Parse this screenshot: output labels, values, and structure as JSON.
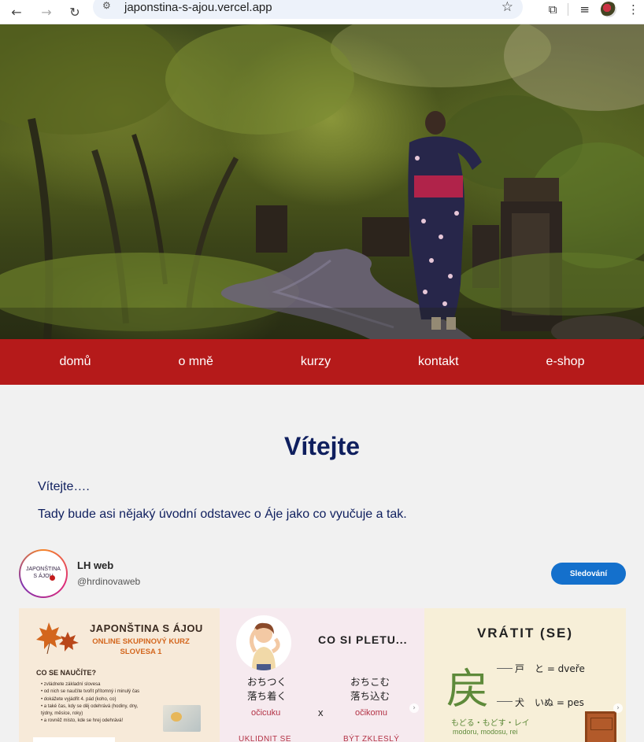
{
  "browser": {
    "url": "japonstina-s-ajou.vercel.app",
    "back_icon": "arrow-left-icon",
    "forward_icon": "arrow-right-icon",
    "reload_icon": "reload-icon",
    "bookmark_icon": "star-icon"
  },
  "menu": {
    "items": [
      {
        "label": "domů"
      },
      {
        "label": "o mně"
      },
      {
        "label": "kurzy"
      },
      {
        "label": "kontakt"
      },
      {
        "label": "e-shop"
      }
    ],
    "color": "#b51a1a"
  },
  "main": {
    "heading": "Vítejte",
    "intro": "Vítejte….",
    "paragraph": "Tady bude asi nějaký úvodní odstavec o Áje jako co vyučuje a tak."
  },
  "instagram": {
    "avatar_line1": "JAPONŠTINA",
    "avatar_line2": "S ÁJOU",
    "name": "LH web",
    "handle": "@hrdinovaweb",
    "follow_label": "Sledování",
    "posts": [
      {
        "title": "JAPONŠTINA S ÁJOU",
        "subtitle_line1": "ONLINE SKUPINOVÝ KURZ",
        "subtitle_line2": "SLOVESA 1",
        "heading": "CO SE NAUČÍTE?",
        "bullets": [
          "• zvládnete základní slovesa",
          "• od nich se naučíte tvořit přítomný i minulý čas",
          "• dokážete vyjádřit 4. pád (koho, co)",
          "• a také čas, kdy se děj odehrává (hodiny, dny,",
          "  týdny, měsíce, roky)",
          "• a rovněž místo, kde se hrej odehrává!"
        ]
      },
      {
        "title": "CO SI PLETU...",
        "left_jp1": "おちつく",
        "left_jp2": "落ち着く",
        "left_reading": "očicuku",
        "right_jp1": "おちこむ",
        "right_jp2": "落ち込む",
        "right_reading": "očikomu",
        "x": "x",
        "left_meaning": "UKLIDNIT SE",
        "right_meaning": "BÝT ZKLESLÝ"
      },
      {
        "title": "VRÁTIT (SE)",
        "kanji": "戻",
        "radical1": "戸",
        "radical1_text": "と = dveře",
        "radical2": "犬",
        "radical2_text": "いぬ = pes",
        "readings_jp": "もどる・もどす・レイ",
        "readings_latin": "modoru, modosu, rei"
      }
    ]
  }
}
